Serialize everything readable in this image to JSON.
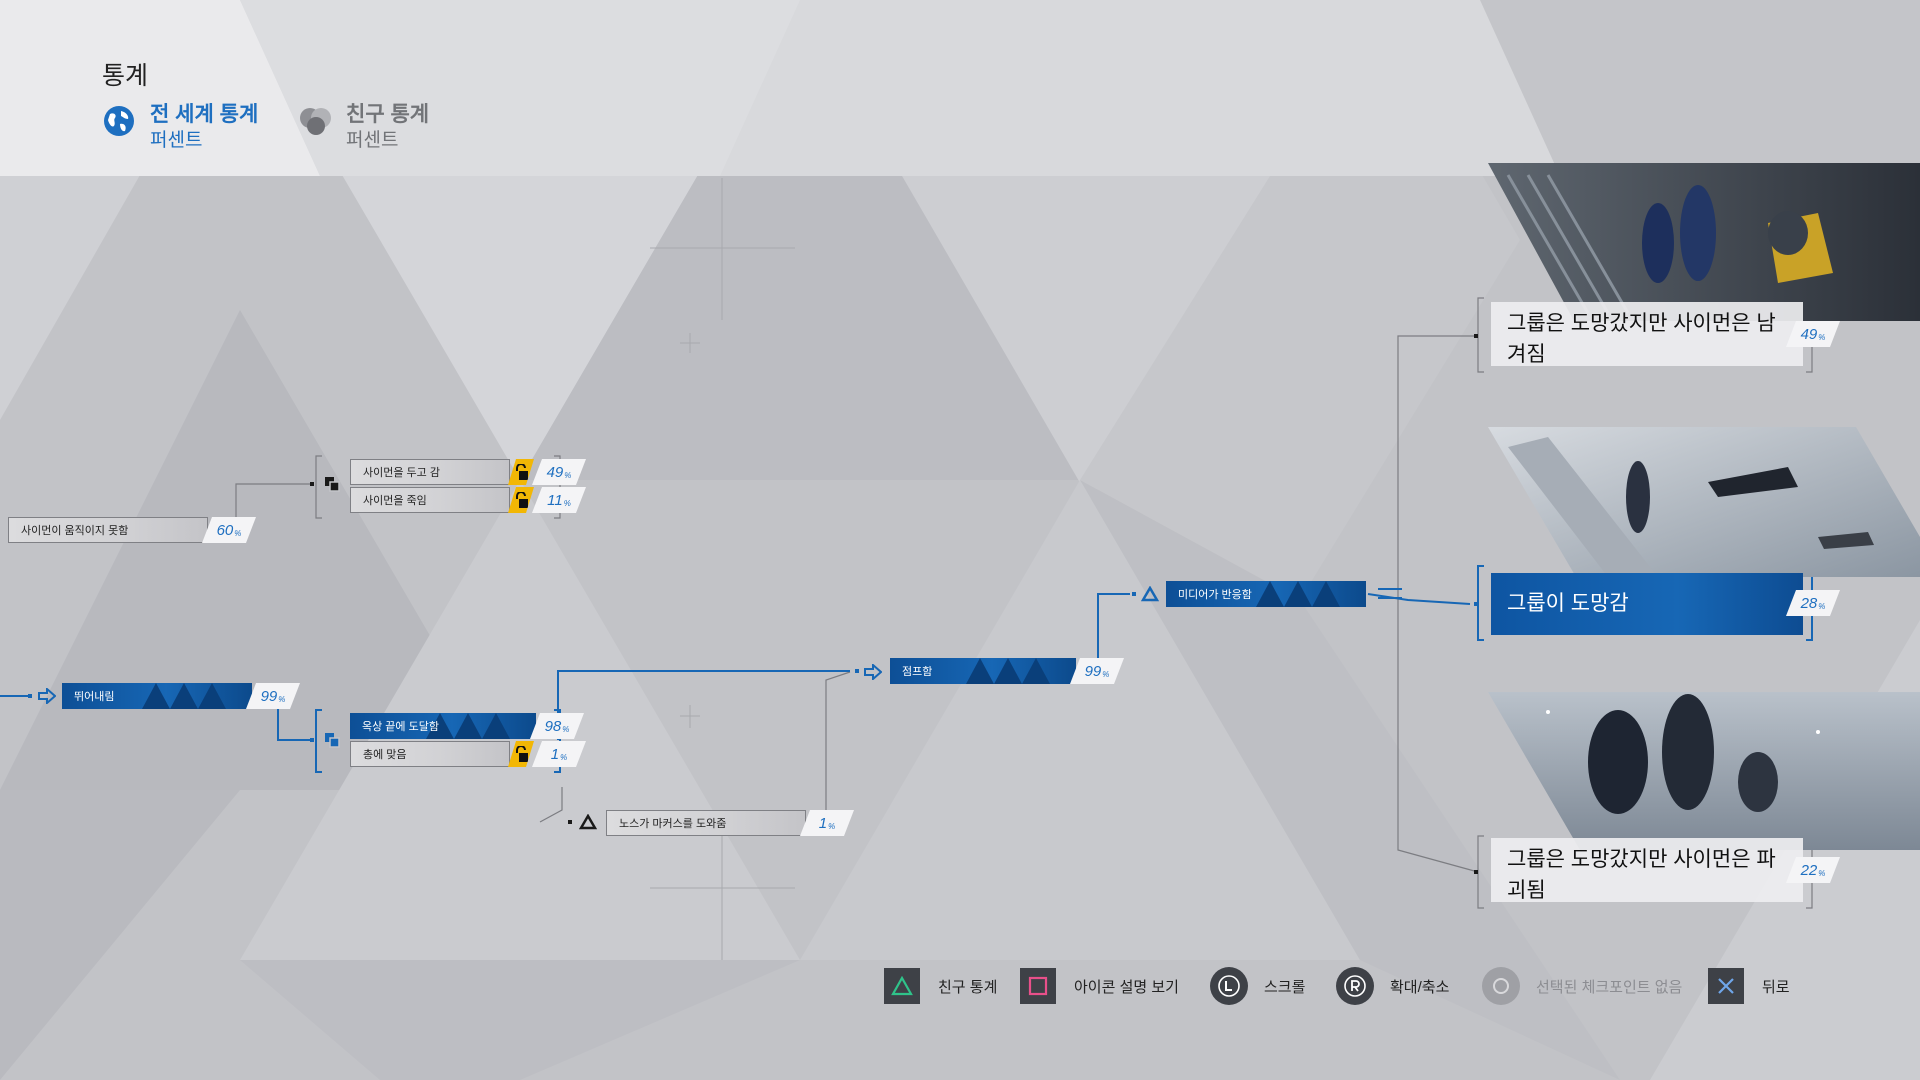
{
  "header": {
    "title": "통계",
    "tabs": [
      {
        "label": "전 세계 통계",
        "sublabel": "퍼센트",
        "icon": "globe-icon",
        "active": true
      },
      {
        "label": "친구 통계",
        "sublabel": "퍼센트",
        "icon": "friends-icon",
        "active": false
      }
    ]
  },
  "flowchart": {
    "nodes": [
      {
        "id": "simon-immobile",
        "label": "사이먼이 움직이지 못함",
        "percent": "60",
        "style": "grey"
      },
      {
        "id": "leave-simon",
        "label": "사이먼을 두고 감",
        "percent": "49",
        "style": "grey",
        "locked": true
      },
      {
        "id": "kill-simon",
        "label": "사이먼을 죽임",
        "percent": "11",
        "style": "grey",
        "locked": true
      },
      {
        "id": "jump-down",
        "label": "뛰어내림",
        "percent": "99",
        "style": "blue"
      },
      {
        "id": "reach-roof-edge",
        "label": "옥상 끝에 도달함",
        "percent": "98",
        "style": "blue"
      },
      {
        "id": "got-shot",
        "label": "총에 맞음",
        "percent": "1",
        "style": "grey",
        "locked": true
      },
      {
        "id": "north-helps",
        "label": "노스가 마커스를 도와줌",
        "percent": "1",
        "style": "grey"
      },
      {
        "id": "jumped",
        "label": "점프함",
        "percent": "99",
        "style": "blue"
      },
      {
        "id": "media-reacts",
        "label": "미디어가 반응함",
        "style": "blue"
      }
    ],
    "outcomes": [
      {
        "id": "escaped-simon-left",
        "label": "그룹은 도망갔지만 사이먼은 남겨짐",
        "percent": "49",
        "active": false
      },
      {
        "id": "group-escaped",
        "label": "그룹이 도망감",
        "percent": "28",
        "active": true
      },
      {
        "id": "escaped-simon-destroyed",
        "label": "그룹은 도망갔지만 사이먼은 파괴됨",
        "percent": "22",
        "active": false
      }
    ],
    "percent_unit": "%"
  },
  "footer": {
    "items": [
      {
        "label": "친구 통계",
        "icon": "triangle-button-icon",
        "color": "#2fc38a"
      },
      {
        "label": "아이콘 설명 보기",
        "icon": "square-button-icon",
        "color": "#e8508a"
      },
      {
        "label": "스크롤",
        "icon": "left-stick-icon"
      },
      {
        "label": "확대/축소",
        "icon": "right-stick-icon"
      },
      {
        "label": "선택된 체크포인트 없음",
        "icon": "circle-button-icon",
        "disabled": true
      },
      {
        "label": "뒤로",
        "icon": "cross-button-icon",
        "color": "#6fa6ea"
      }
    ]
  },
  "colors": {
    "accent": "#1e6fc0",
    "node_blue": "#1767b5",
    "lock_yellow": "#f2b705",
    "background": "#c3c4c8"
  }
}
